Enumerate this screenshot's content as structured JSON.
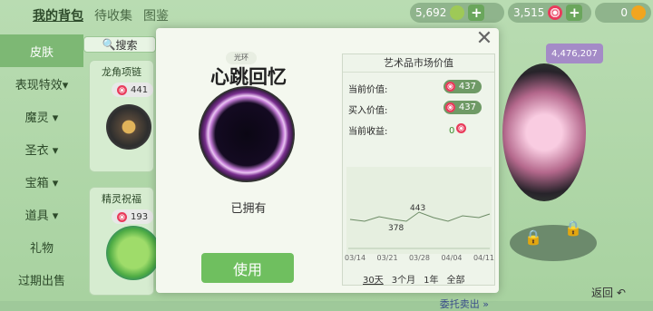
{
  "nav": {
    "tabs": [
      "我的背包",
      "待收集",
      "图鉴"
    ],
    "active": "我的背包"
  },
  "currency": {
    "gems": "5,692",
    "candy": "3,515",
    "coins": "0"
  },
  "sidebar": {
    "items": [
      {
        "label": "皮肤",
        "active": true
      },
      {
        "label": "表现特效▾"
      },
      {
        "label": "魔灵 ▾"
      },
      {
        "label": "圣衣 ▾"
      },
      {
        "label": "宝箱 ▾"
      },
      {
        "label": "道具 ▾"
      },
      {
        "label": "礼物"
      },
      {
        "label": "过期出售"
      }
    ]
  },
  "search": {
    "label": "搜索"
  },
  "cards": [
    {
      "title": "龙角项链",
      "price": "441"
    },
    {
      "title": "精灵祝福",
      "price": "193"
    }
  ],
  "right_panel": {
    "badge": "4,476,207"
  },
  "modal": {
    "tag": "光环",
    "item_name": "心跳回忆",
    "owned_label": "已拥有",
    "use_button": "使用",
    "market": {
      "title": "艺术品市场价值",
      "current_value_label": "当前价值:",
      "current_value": "437",
      "buy_value_label": "买入价值:",
      "buy_value": "437",
      "profit_label": "当前收益:",
      "profit_value": "0",
      "chart_points": {
        "high": "443",
        "low": "378"
      },
      "x_ticks": [
        "03/14",
        "03/21",
        "03/28",
        "04/04",
        "04/11"
      ],
      "ranges": [
        "30天",
        "3个月",
        "1年",
        "全部"
      ],
      "active_range": "30天",
      "consign": "委托卖出 »"
    }
  },
  "footer": {
    "back": "返回"
  },
  "colors": {
    "accent": "#6fbf5f",
    "candy": "#e93c5c"
  }
}
